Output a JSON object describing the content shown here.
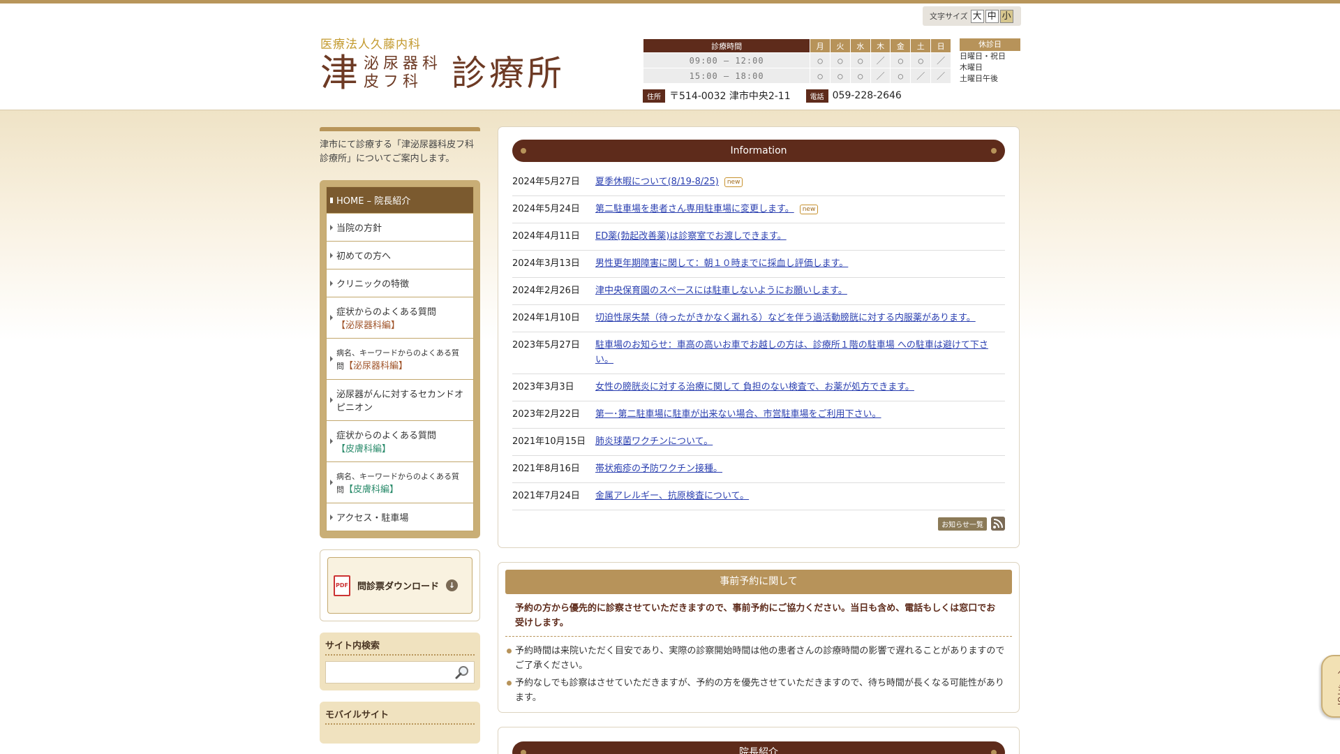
{
  "font_size": {
    "label": "文字サイズ",
    "large": "大",
    "medium": "中",
    "small": "小"
  },
  "logo": {
    "sub": "医療法人久藤内科",
    "main_left": "津",
    "dept_line1": "泌尿器科",
    "dept_line2": "皮フ科",
    "main_right": "診療所"
  },
  "hours": {
    "header": "診療時間",
    "days": [
      "月",
      "火",
      "水",
      "木",
      "金",
      "土",
      "日"
    ],
    "rows": [
      {
        "time": "09:00 – 12:00",
        "marks": [
          "○",
          "○",
          "○",
          "／",
          "○",
          "○",
          "／"
        ]
      },
      {
        "time": "15:00 – 18:00",
        "marks": [
          "○",
          "○",
          "○",
          "／",
          "○",
          "／",
          "／"
        ]
      }
    ]
  },
  "closed": {
    "title": "休診日",
    "items": [
      "日曜日・祝日",
      "木曜日",
      "土曜日午後"
    ]
  },
  "address": {
    "tag": "住所",
    "value": "〒514-0032 津市中央2-11",
    "phone_tag": "電話",
    "phone": "059-228-2646"
  },
  "sidebar": {
    "intro": "津市にて診療する「津泌尿器科皮フ科診療所」についてご案内します。",
    "nav": [
      {
        "label": "HOME – 院長紹介"
      },
      {
        "label": "当院の方針"
      },
      {
        "label": "初めての方へ"
      },
      {
        "label": "クリニックの特徴"
      },
      {
        "label": "症状からのよくある質問",
        "sub": "【泌尿器科編】"
      },
      {
        "label": "病名、キーワードからのよくある質問",
        "sub": "【泌尿器科編】"
      },
      {
        "label": "泌尿器がんに対するセカンドオピニオン"
      },
      {
        "label": "症状からのよくある質問",
        "sub": "【皮膚科編】"
      },
      {
        "label": "病名、キーワードからのよくある質問",
        "sub": "【皮膚科編】"
      },
      {
        "label": "アクセス・駐車場"
      }
    ],
    "download": "問診票ダウンロード",
    "pdf_label": "PDF",
    "search_title": "サイト内検索",
    "mobile_title": "モバイルサイト"
  },
  "info": {
    "title": "Information",
    "new_label": "new",
    "items": [
      {
        "date": "2024年5月27日",
        "text": "夏季休暇について(8/19-8/25)",
        "new": true
      },
      {
        "date": "2024年5月24日",
        "text": "第二駐車場を患者さん専用駐車場に変更します。",
        "new": true
      },
      {
        "date": "2024年4月11日",
        "text": "ED薬(勃起改善薬)は診察室でお渡しできます。"
      },
      {
        "date": "2024年3月13日",
        "text": "男性更年期障害に関して：朝１０時までに採血し評価します。"
      },
      {
        "date": "2024年2月26日",
        "text": "津中央保育園のスペースには駐車しないようにお願いします。"
      },
      {
        "date": "2024年1月10日",
        "text": "切迫性尿失禁（待ったがきかなく漏れる）などを伴う過活動膀胱に対する内服薬があります。"
      },
      {
        "date": "2023年5月27日",
        "text": "駐車場のお知らせ：車高の高いお車でお越しの方は、診療所１階の駐車場 への駐車は避けて下さい。"
      },
      {
        "date": "2023年3月3日",
        "text": "女性の膀胱炎に対する治療に関して 負担のない検査で、お薬が処方できます。"
      },
      {
        "date": "2023年2月22日",
        "text": "第一･第二駐車場に駐車が出来ない場合、市営駐車場をご利用下さい。"
      },
      {
        "date": "2021年10月15日",
        "text": "肺炎球菌ワクチンについて。"
      },
      {
        "date": "2021年8月16日",
        "text": "帯状疱疹の予防ワクチン接種。"
      },
      {
        "date": "2021年7月24日",
        "text": "金属アレルギー、抗原検査について。"
      }
    ],
    "more_label": "お知らせ一覧"
  },
  "reserve": {
    "title": "事前予約に関して",
    "lead": "予約の方から優先的に診察させていただきますので、事前予約にご協力ください。当日も含め、電話もしくは窓口でお受けします。",
    "items": [
      "予約時間は来院いただく目安であり、実際の診察開始時間は他の患者さんの診療時間の影響で遅れることがありますのでご了承ください。",
      "予約なしでも診察はさせていただきますが、予約の方を優先させていただきますので、待ち時間が長くなる可能性があります。"
    ]
  },
  "doctor": {
    "title": "院長紹介"
  },
  "pagetop": "ページTOP"
}
